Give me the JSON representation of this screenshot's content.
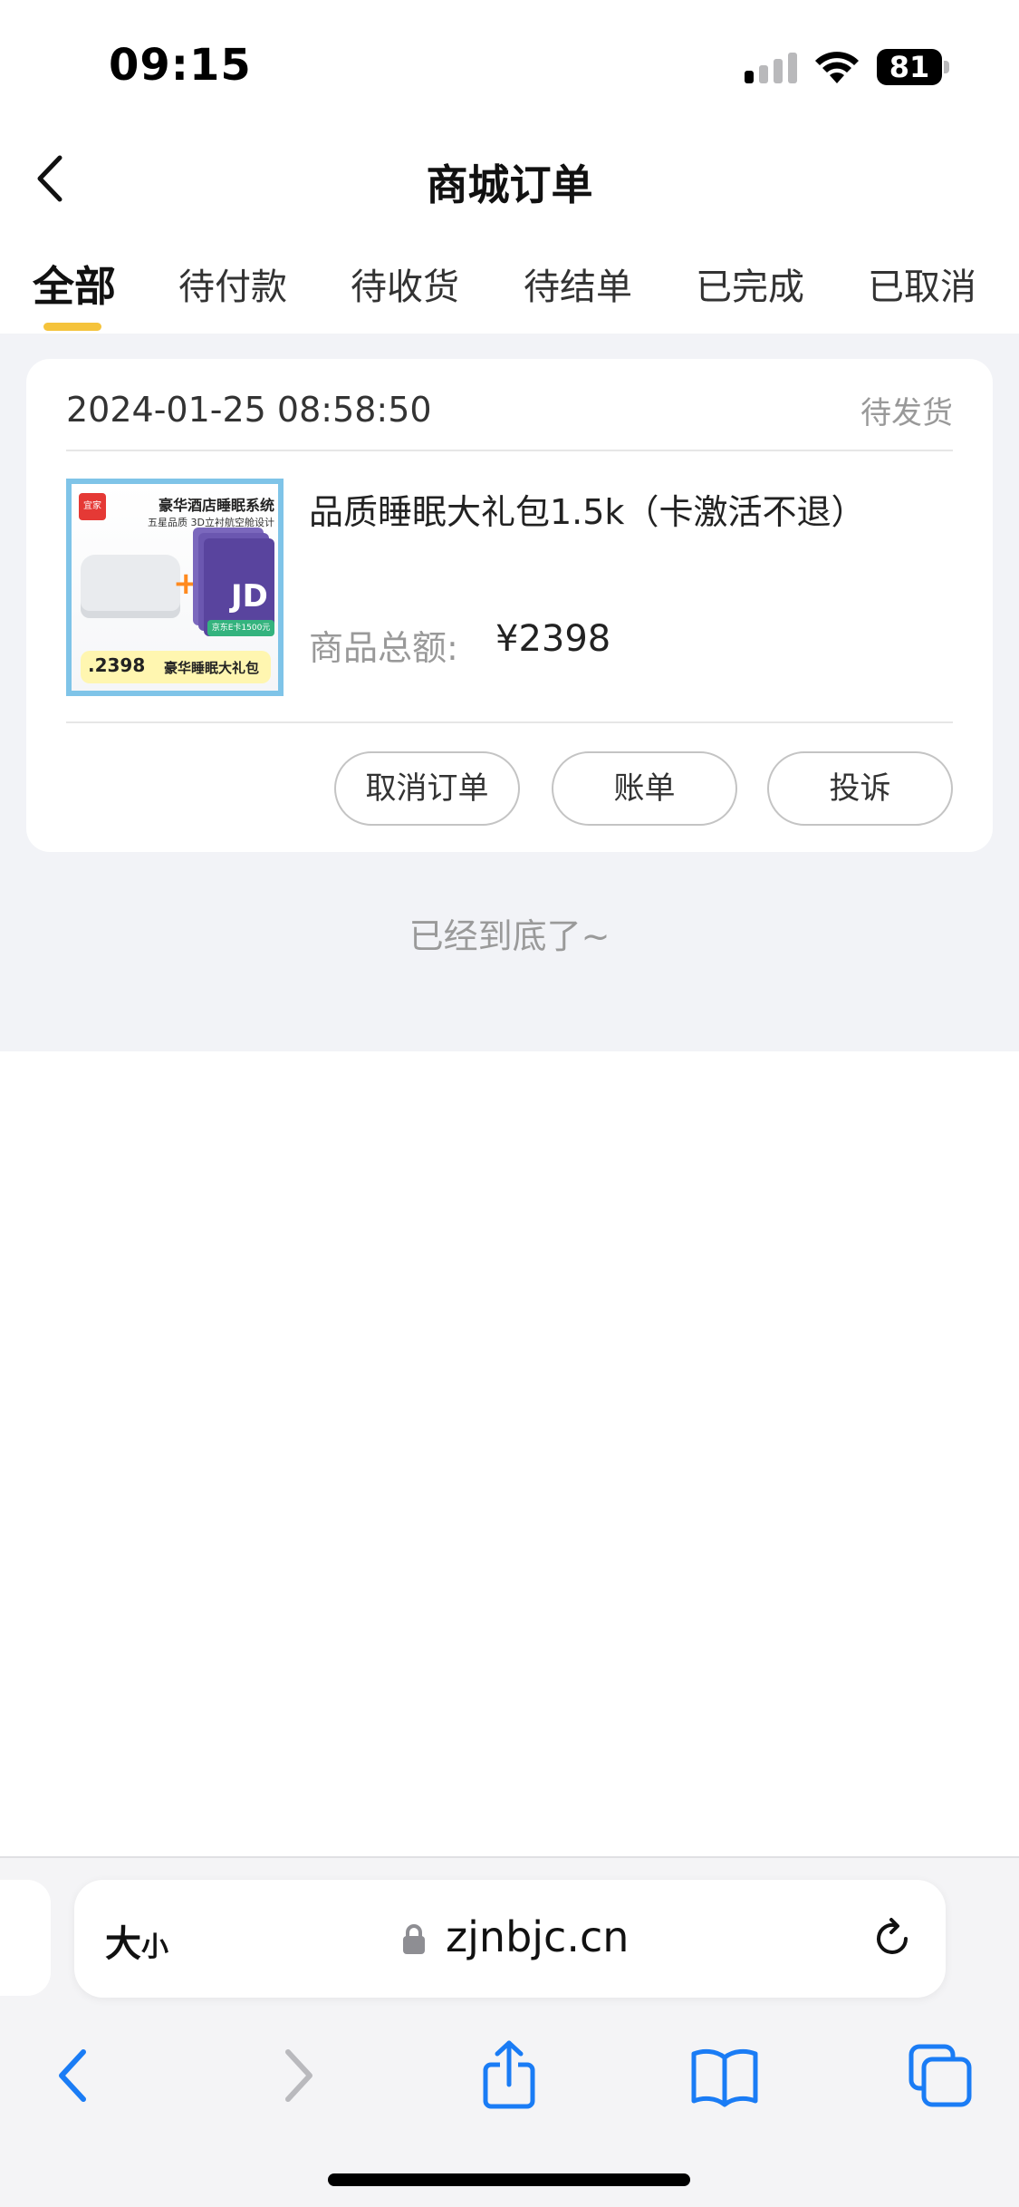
{
  "status_bar": {
    "time": "09:15",
    "battery": "81"
  },
  "nav": {
    "title": "商城订单"
  },
  "tabs": [
    {
      "label": "全部",
      "active": true
    },
    {
      "label": "待付款",
      "active": false
    },
    {
      "label": "待收货",
      "active": false
    },
    {
      "label": "待结单",
      "active": false
    },
    {
      "label": "已完成",
      "active": false
    },
    {
      "label": "已取消",
      "active": false
    }
  ],
  "order": {
    "time": "2024-01-25 08:58:50",
    "status": "待发货",
    "product_name": "品质睡眠大礼包1.5k（卡激活不退）",
    "total_label": "商品总额:",
    "total_value": "¥2398",
    "image": {
      "logo": "宜家",
      "title": "豪华酒店睡眠系统",
      "subtitle": "五星品质 3D立衬航空舱设计",
      "card_label": "京东E卡1500元",
      "card_mark": "JD",
      "price": ".2398",
      "bottom_label": "豪华睡眠大礼包"
    },
    "buttons": {
      "cancel": "取消订单",
      "bill": "账单",
      "complaint": "投诉"
    }
  },
  "list_end": "已经到底了~",
  "browser": {
    "text_size": "大",
    "text_size_small": "小",
    "url": "zjnbjc.cn"
  },
  "colors": {
    "accent": "#f5c33b",
    "background": "#f2f3f7",
    "link_blue": "#1a7cf5"
  },
  "icons": [
    "back-chevron-icon",
    "signal-icon",
    "wifi-icon",
    "battery-icon",
    "lock-icon",
    "reload-icon",
    "browser-back-icon",
    "browser-forward-icon",
    "share-icon",
    "bookmarks-icon",
    "tabs-icon"
  ]
}
